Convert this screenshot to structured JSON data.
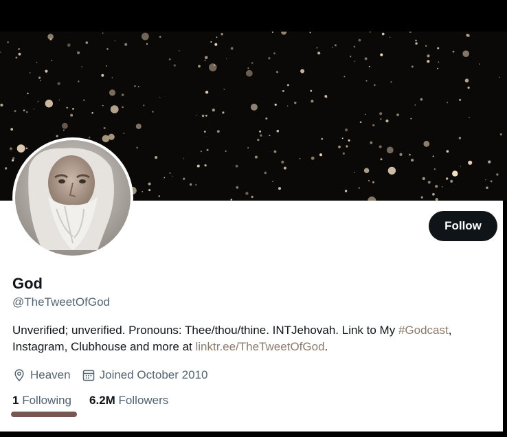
{
  "profile": {
    "name": "God",
    "handle": "@TheTweetOfGod",
    "follow_label": "Follow",
    "bio": {
      "text1": "Unverified; unverified. Pronouns: Thee/thou/thine. INTJehovah. Link to My ",
      "hashtag": "#Godcast",
      "text2": ", Instagram, Clubhouse and more at ",
      "link": "linktr.ee/TheTweetOfGod",
      "text3": "."
    },
    "location": "Heaven",
    "joined": "Joined October 2010",
    "following_count": "1",
    "following_label": "Following",
    "followers_count": "6.2M",
    "followers_label": "Followers"
  },
  "icons": {
    "location": "location-pin-icon",
    "calendar": "calendar-icon"
  },
  "colors": {
    "follow_button": "#0f1419",
    "link": "#8c7a6c",
    "muted_text": "#536471",
    "underline": "#7a5552"
  }
}
